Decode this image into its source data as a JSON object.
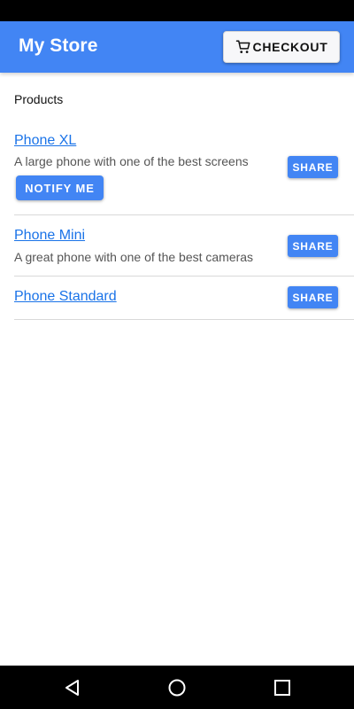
{
  "app_bar": {
    "title": "My Store",
    "checkout_label": "CHECKOUT",
    "checkout_icon": "shopping-cart-icon"
  },
  "products_section": {
    "title": "Products",
    "items": [
      {
        "name": "Phone XL",
        "description": "A large phone with one of the best screens",
        "share_label": "SHARE",
        "notify_label": "NOTIFY ME"
      },
      {
        "name": "Phone Mini",
        "description": "A great phone with one of the best cameras",
        "share_label": "SHARE"
      },
      {
        "name": "Phone Standard",
        "share_label": "SHARE"
      }
    ]
  },
  "navigation": {
    "back_icon": "back-triangle-icon",
    "home_icon": "home-circle-icon",
    "recents_icon": "recents-square-icon"
  },
  "colors": {
    "primary": "#4285f4",
    "link": "#1a73e8",
    "status_bar": "#000000",
    "nav_bar": "#000000"
  }
}
